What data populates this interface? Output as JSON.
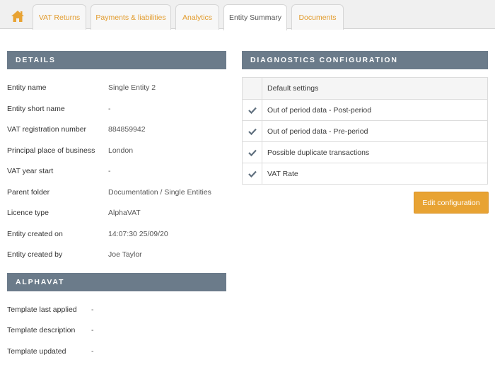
{
  "tabs": [
    {
      "label": "VAT Returns"
    },
    {
      "label": "Payments & liabilities"
    },
    {
      "label": "Analytics"
    },
    {
      "label": "Entity Summary"
    },
    {
      "label": "Documents"
    }
  ],
  "details": {
    "title": "DETAILS",
    "rows": [
      {
        "label": "Entity name",
        "value": "Single Entity 2"
      },
      {
        "label": "Entity short name",
        "value": "-"
      },
      {
        "label": "VAT registration number",
        "value": "884859942"
      },
      {
        "label": "Principal place of business",
        "value": "London"
      },
      {
        "label": "VAT year start",
        "value": "-"
      },
      {
        "label": "Parent folder",
        "value": "Documentation / Single Entities"
      },
      {
        "label": "Licence type",
        "value": "AlphaVAT"
      },
      {
        "label": "Entity created on",
        "value": "14:07:30 25/09/20"
      },
      {
        "label": "Entity created by",
        "value": "Joe Taylor"
      }
    ]
  },
  "alphavat": {
    "title": "ALPHAVAT",
    "rows": [
      {
        "label": "Template last applied",
        "value": "-"
      },
      {
        "label": "Template description",
        "value": "-"
      },
      {
        "label": "Template updated",
        "value": "-"
      }
    ]
  },
  "diagnostics": {
    "title": "DIAGNOSTICS CONFIGURATION",
    "header": "Default settings",
    "items": [
      {
        "label": "Out of period data - Post-period"
      },
      {
        "label": "Out of period data - Pre-period"
      },
      {
        "label": "Possible duplicate transactions"
      },
      {
        "label": "VAT Rate"
      }
    ],
    "edit_label": "Edit configuration"
  },
  "colors": {
    "accent": "#e8a333",
    "header_bg": "#6b7b8a",
    "home_icon": "#e8a333"
  }
}
